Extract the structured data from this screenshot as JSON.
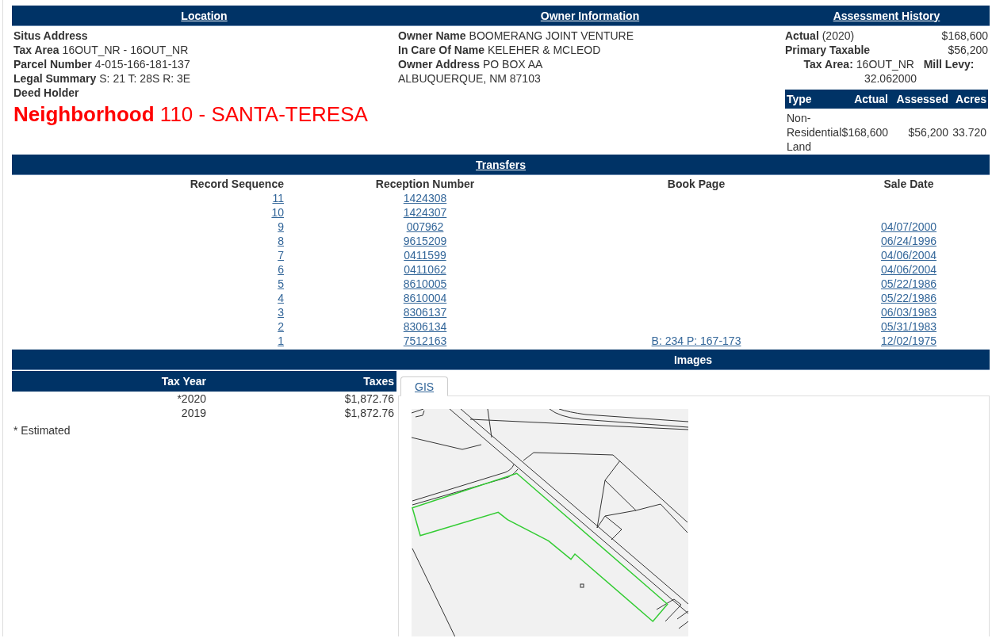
{
  "location": {
    "title": "Location",
    "fields": [
      {
        "label": "Situs Address"
      },
      {
        "label": "Tax Area",
        "value": "16OUT_NR - 16OUT_NR"
      },
      {
        "label": "Parcel Number",
        "value": "4-015-166-181-137"
      },
      {
        "label": "Legal Summary",
        "value": "S: 21 T: 28S R: 3E"
      },
      {
        "label": "Deed Holder"
      }
    ],
    "neighborhood": "**Neighborhood** 110 - SANTA-TERESA"
  },
  "owner": {
    "title": "Owner Information",
    "fields": [
      {
        "label": "Owner Name",
        "value": "BOOMERANG JOINT VENTURE"
      },
      {
        "label": "In Care Of Name",
        "value": "KELEHER & MCLEOD"
      },
      {
        "label": "Owner Address",
        "value": "PO BOX AA",
        "line2": "ALBUQUERQUE, NM 87103"
      }
    ]
  },
  "assessment": {
    "title": "Assessment History",
    "actual": {
      "label": "Actual",
      "year": "(2020)",
      "value": "$168,600"
    },
    "primary_taxable": {
      "label": "Primary Taxable",
      "value": "$56,200"
    },
    "tax_area": {
      "label": "Tax Area:",
      "value": "16OUT_NR"
    },
    "mill_levy": {
      "label": "Mill Levy:",
      "value": "32.062000"
    },
    "columns": [
      "Type",
      "Actual",
      "Assessed",
      "Acres"
    ],
    "rows": [
      [
        "Non-Residential Land",
        "$168,600",
        "$56,200",
        "33.720"
      ]
    ]
  },
  "transfers": {
    "title": "Transfers",
    "columns": [
      "Record Sequence",
      "Reception Number",
      "Book Page",
      "Sale Date"
    ],
    "rows": [
      {
        "sequence": "11",
        "reception": "1424308"
      },
      {
        "sequence": "10",
        "reception": "1424307"
      },
      {
        "sequence": "9",
        "reception": "007962",
        "sale_date": "04/07/2000"
      },
      {
        "sequence": "8",
        "reception": "9615209",
        "sale_date": "06/24/1996"
      },
      {
        "sequence": "7",
        "reception": "0411599",
        "sale_date": "04/06/2004"
      },
      {
        "sequence": "6",
        "reception": "0411062",
        "sale_date": "04/06/2004"
      },
      {
        "sequence": "5",
        "reception": "8610005",
        "sale_date": "05/22/1986"
      },
      {
        "sequence": "4",
        "reception": "8610004",
        "sale_date": "05/22/1986"
      },
      {
        "sequence": "3",
        "reception": "8306137",
        "sale_date": "06/03/1983"
      },
      {
        "sequence": "2",
        "reception": "8306134",
        "sale_date": "05/31/1983"
      },
      {
        "sequence": "1",
        "reception": "7512163",
        "book_page": "B: 234 P: 167-173",
        "sale_date": "12/02/1975"
      }
    ]
  },
  "taxes": {
    "columns": [
      "Tax Year",
      "Taxes"
    ],
    "rows": [
      [
        "*2020",
        "$1,872.76"
      ],
      [
        "2019",
        "$1,872.76"
      ]
    ],
    "note": "* Estimated"
  },
  "images": {
    "title": "Images",
    "tabs": [
      {
        "label": "GIS",
        "selected": true
      }
    ]
  }
}
